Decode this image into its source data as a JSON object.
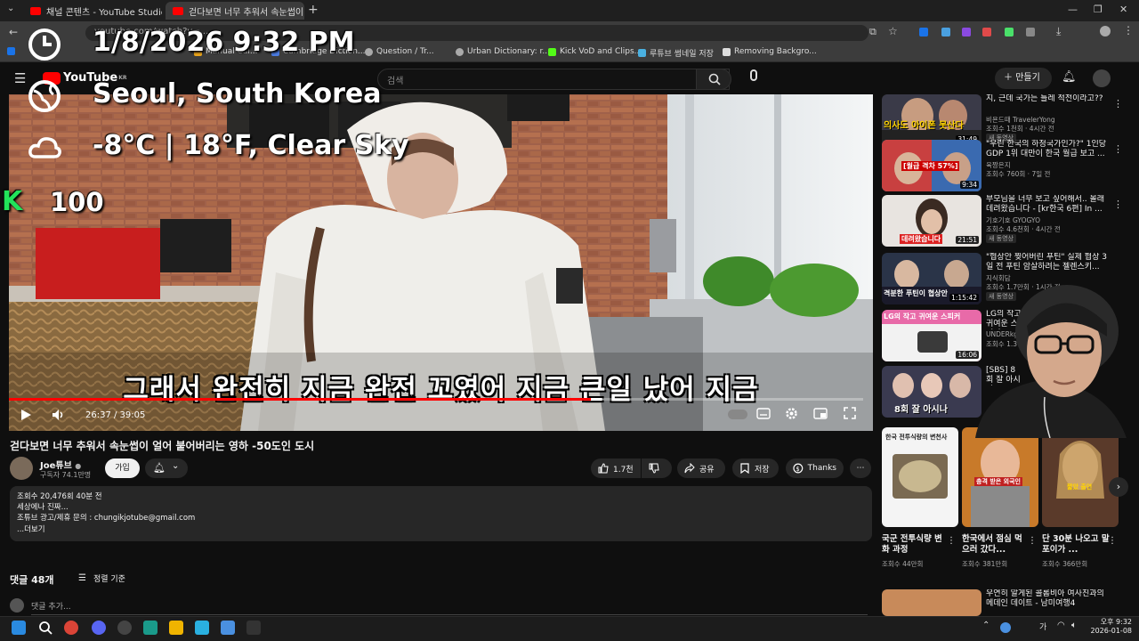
{
  "browser": {
    "tabs": [
      {
        "label": "채널 콘텐츠 - YouTube Studio"
      },
      {
        "label": "걷다보면 너무 추워서 속눈썹이"
      }
    ],
    "url": "youtube.com/watch?v=...",
    "bookmarks": [
      "Manual Cal...",
      "Cambridge Diction...",
      "Question / Tr...",
      "Urban Dictionary: r...",
      "Kick VoD and Clips...",
      "루튜브 썸네일 저장",
      "Removing Backgro..."
    ]
  },
  "youtube": {
    "logo": "YouTube",
    "logo_region": "KR",
    "search_placeholder": "검색",
    "create_label": "만들기"
  },
  "overlay": {
    "datetime": "1/8/2026 9:32 PM",
    "location": "Seoul, South Korea",
    "weather": "-8°C | 18°F, Clear Sky",
    "k_label": "K",
    "k_value": "100"
  },
  "player": {
    "subtitle": "그래서 완전히 지금 완전 꼬였어 지금 큰일 났어 지금",
    "timecode": "26:37 / 39:05",
    "progress": 0.681
  },
  "video": {
    "title": "걷다보면 너무 추워서 속눈썹이 얼어 붙어버리는 영하 -50도인 도시",
    "channel": "Joe튜브",
    "subscribers": "구독자 74.1만명",
    "join": "가입",
    "likes": "1.7천",
    "share": "공유",
    "save": "저장",
    "thanks": "Thanks",
    "description": {
      "line1": "조회수 20,476회  40분 전",
      "line2": "세상에나 진짜...",
      "line3": "조튜브 광고/제휴 문의 : chungikjotube@gmail.com",
      "more": "...더보기"
    },
    "comments_count": "댓글 48개",
    "sort_label": "정렬 기준",
    "add_comment": "댓글 추가..."
  },
  "recommendations": [
    {
      "title": "지, 근데 국가는 틀레 적전이라고??",
      "channel": "비욘드때 TravelerYong",
      "meta": "조회수 1천회 · 4시간 전",
      "badge": "새 동영상",
      "duration": "31:49",
      "thumb_text": "의사도 아이폰 못산다"
    },
    {
      "title": "\"우린 한국의 하청국가인가?\" 1인당 GDP 1위 대만이 한국 월급 보고 ...",
      "channel": "육짱은지",
      "meta": "조회수 760회 · 7일 전",
      "badge": "",
      "duration": "9:34",
      "thumb_text": "[월급 격차 57%]"
    },
    {
      "title": "부모님을 너무 보고 싶어해서.. 몰래 데려왔습니다 - [kr한국 6편] In ...",
      "channel": "기호기호 GYOGYO",
      "meta": "조회수 4.6천회 · 4시간 전",
      "badge": "새 동영상",
      "duration": "21:51",
      "thumb_text": "데려왔습니다"
    },
    {
      "title": "\"협상안 찢어버린 푸틴\" 실제 협상 3일 전 푸틴 암살하려는 젤렌스키...",
      "channel": "지식회담",
      "meta": "조회수 1.7만회 · 1시간 전",
      "badge": "새 동영상",
      "duration": "1:15:42",
      "thumb_text": "격분한 푸틴이 협상안"
    },
    {
      "title": "LG의 작고 귀여운 스피커",
      "channel": "UNDERkg",
      "meta": "조회수 1.3만회",
      "badge": "새 동영상",
      "duration": "16:06",
      "thumb_text": "LG의 작고 귀여운 스피커"
    },
    {
      "title": "[SBS] 8회 잘 아시나...",
      "channel": "",
      "meta": "",
      "badge": "",
      "duration": "",
      "thumb_text": "8회 잘 아시나"
    }
  ],
  "shorts": [
    {
      "title": "국군 전투식량 변화 과정",
      "views": "조회수 44만회",
      "thumb_text": "한국 전투식량의 변천사"
    },
    {
      "title": "한국에서 점심 먹으러 갔다...",
      "views": "조회수 381만회",
      "thumb_text": "충격 받은 외국인"
    },
    {
      "title": "단 30분 나오고 말포이가 ...",
      "views": "조회수 366만회",
      "thumb_text": "짧았 출연"
    }
  ],
  "bottom_rec": {
    "title": "우연히 알게된 콜롬비아 여사친과의 메데인 데이트 - 남미여행4"
  },
  "taskbar": {
    "time": "오후 9:32",
    "date": "2026-01-08"
  },
  "colors": {
    "yt_red": "#ff0000",
    "bg": "#0f0f0f",
    "chip": "#272727",
    "overlay_green": "#22e35a"
  }
}
